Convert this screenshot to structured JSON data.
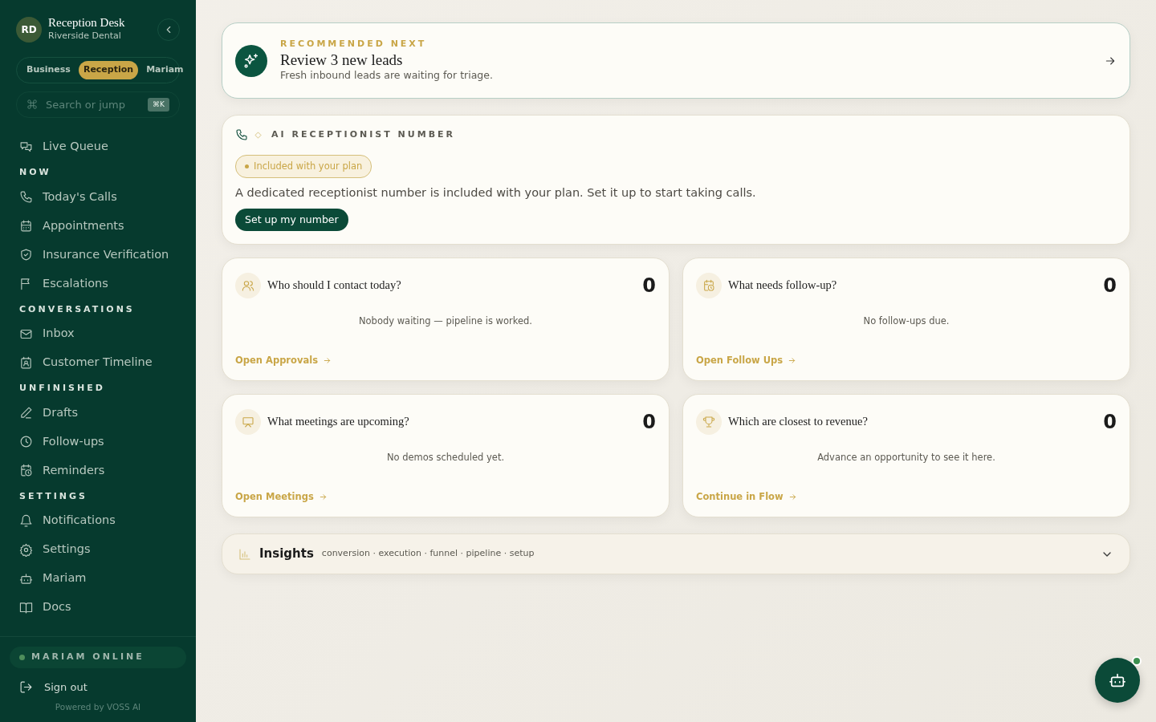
{
  "sidebar": {
    "avatar": "RD",
    "title": "Reception Desk",
    "subtitle": "Riverside Dental",
    "scopes": [
      {
        "label": "Business",
        "selected": false
      },
      {
        "label": "Reception",
        "selected": true
      },
      {
        "label": "Mariam",
        "selected": false
      }
    ],
    "search": {
      "placeholder": "Search or jump",
      "shortcut": "⌘K"
    },
    "top_items": [
      "Live Queue"
    ],
    "sections": [
      {
        "title": "NOW",
        "items": [
          "Today's Calls",
          "Appointments",
          "Insurance Verification",
          "Escalations"
        ]
      },
      {
        "title": "CONVERSATIONS",
        "items": [
          "Inbox",
          "Customer Timeline"
        ]
      },
      {
        "title": "UNFINISHED",
        "items": [
          "Drafts",
          "Follow-ups",
          "Reminders"
        ]
      },
      {
        "title": "SETTINGS",
        "items": [
          "Notifications",
          "Settings",
          "Mariam",
          "Docs"
        ]
      }
    ],
    "status": "MARIAM ONLINE",
    "sign_out": "Sign out",
    "footer": "Powered by VOSS AI"
  },
  "recommended": {
    "eyebrow": "RECOMMENDED NEXT",
    "title": "Review 3 new leads",
    "subtitle": "Fresh inbound leads are waiting for triage."
  },
  "number_card": {
    "eyebrow": "AI RECEPTIONIST NUMBER",
    "badge": "Included with your plan",
    "text": "A dedicated receptionist number is included with your plan. Set it up to start taking calls.",
    "button": "Set up my number"
  },
  "cards": [
    {
      "question": "Who should I contact today?",
      "count": "0",
      "empty": "Nobody waiting — pipeline is worked.",
      "link": "Open Approvals"
    },
    {
      "question": "What needs follow-up?",
      "count": "0",
      "empty": "No follow-ups due.",
      "link": "Open Follow Ups"
    },
    {
      "question": "What meetings are upcoming?",
      "count": "0",
      "empty": "No demos scheduled yet.",
      "link": "Open Meetings"
    },
    {
      "question": "Which are closest to revenue?",
      "count": "0",
      "empty": "Advance an opportunity to see it here.",
      "link": "Continue in Flow"
    }
  ],
  "insights": {
    "title": "Insights",
    "tags": "conversion · execution · funnel · pipeline · setup",
    "expanded": false
  },
  "assistant": {
    "online": true
  }
}
